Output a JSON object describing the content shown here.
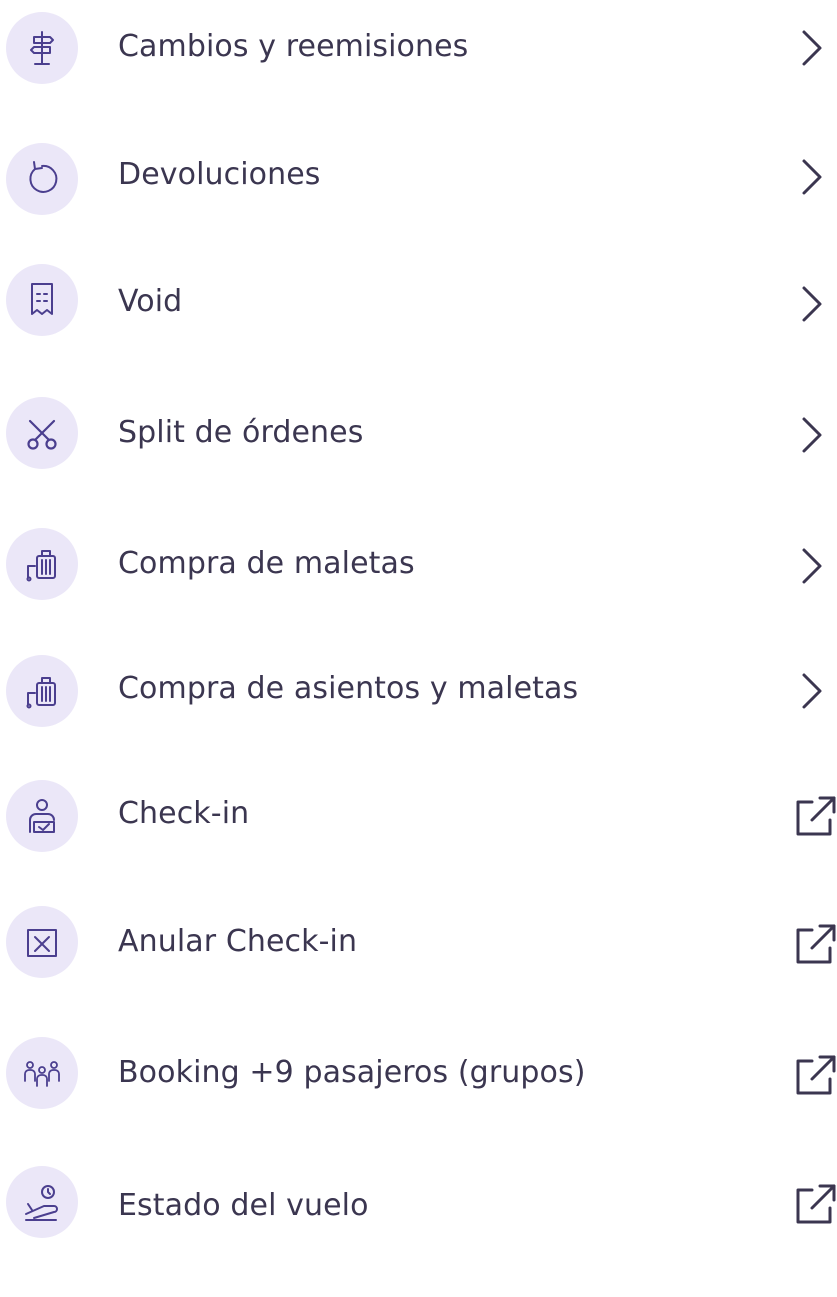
{
  "menu": {
    "items": [
      {
        "label": "Cambios y reemisiones",
        "icon": "signpost-icon",
        "trailing": "chevron-right-icon"
      },
      {
        "label": "Devoluciones",
        "icon": "refund-arrow-icon",
        "trailing": "chevron-right-icon"
      },
      {
        "label": "Void",
        "icon": "void-ticket-icon",
        "trailing": "chevron-right-icon"
      },
      {
        "label": "Split de órdenes",
        "icon": "scissors-icon",
        "trailing": "chevron-right-icon"
      },
      {
        "label": "Compra de maletas",
        "icon": "luggage-icon",
        "trailing": "chevron-right-icon"
      },
      {
        "label": "Compra de asientos y maletas",
        "icon": "luggage-icon",
        "trailing": "chevron-right-icon"
      },
      {
        "label": "Check-in",
        "icon": "person-check-icon",
        "trailing": "external-link-icon"
      },
      {
        "label": "Anular Check-in",
        "icon": "cancel-box-icon",
        "trailing": "external-link-icon"
      },
      {
        "label": "Booking +9 pasajeros (grupos)",
        "icon": "group-people-icon",
        "trailing": "external-link-icon"
      },
      {
        "label": "Estado del vuelo",
        "icon": "flight-status-icon",
        "trailing": "external-link-icon"
      }
    ]
  },
  "colors": {
    "icon_background": "#ebe7f8",
    "icon_stroke": "#4b3f8f",
    "text": "#3b3650",
    "trailing": "#3b3650"
  }
}
